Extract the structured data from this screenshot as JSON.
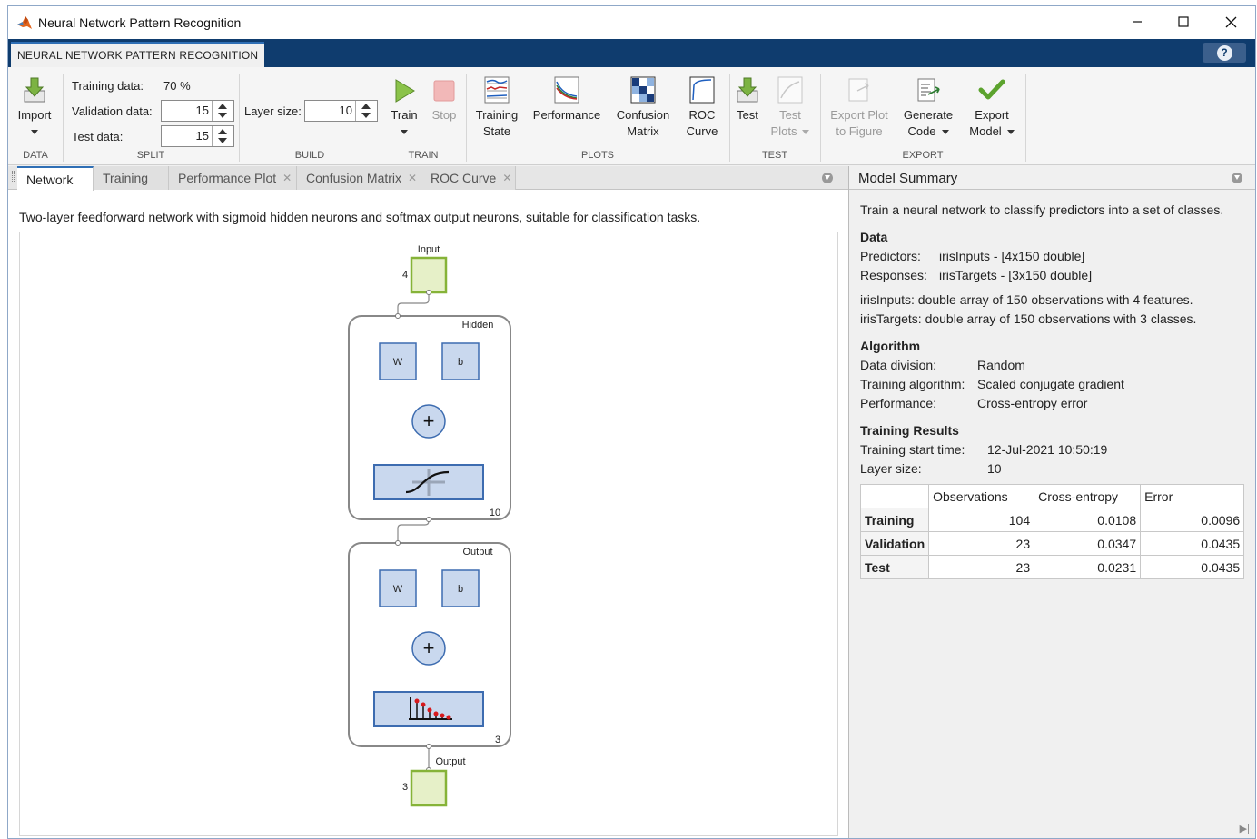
{
  "window": {
    "title": "Neural Network Pattern Recognition",
    "controls": [
      "minimize-icon",
      "maximize-icon",
      "close-icon"
    ]
  },
  "toolstrip_tab": "NEURAL NETWORK PATTERN RECOGNITION",
  "toolstrip": {
    "data": {
      "section": "DATA",
      "import_label": "Import"
    },
    "split": {
      "section": "SPLIT",
      "training_label": "Training data:",
      "training_value": "70 %",
      "validation_label": "Validation data:",
      "validation_value": "15",
      "test_label": "Test data:",
      "test_value": "15"
    },
    "build": {
      "section": "BUILD",
      "layer_size_label": "Layer size:",
      "layer_size_value": "10"
    },
    "train": {
      "section": "TRAIN",
      "train_label": "Train",
      "stop_label": "Stop"
    },
    "plots": {
      "section": "PLOTS",
      "training_state": [
        "Training",
        "State"
      ],
      "performance": "Performance",
      "confusion": [
        "Confusion",
        "Matrix"
      ],
      "roc": [
        "ROC",
        "Curve"
      ]
    },
    "test": {
      "section": "TEST",
      "test_label": "Test",
      "test_plots": [
        "Test",
        "Plots"
      ]
    },
    "export": {
      "section": "EXPORT",
      "export_plot": [
        "Export Plot",
        "to Figure"
      ],
      "generate_code": [
        "Generate",
        "Code"
      ],
      "export_model": [
        "Export",
        "Model"
      ]
    }
  },
  "doc_tabs": [
    "Network",
    "Training",
    "Performance Plot",
    "Confusion Matrix",
    "ROC Curve"
  ],
  "network": {
    "description": "Two-layer feedforward network with sigmoid hidden neurons and softmax output neurons, suitable for classification tasks.",
    "input_label": "Input",
    "input_size": "4",
    "hidden_label": "Hidden",
    "hidden_size": "10",
    "output_layer_label": "Output",
    "output_size": "3",
    "output_label": "Output",
    "output_node_size": "3",
    "w_label": "W",
    "b_label": "b"
  },
  "summary": {
    "title": "Model Summary",
    "intro": "Train a neural network to classify predictors into a set of classes.",
    "data_heading": "Data",
    "predictors_label": "Predictors:",
    "predictors_value": "irisInputs - [4x150 double]",
    "responses_label": "Responses:",
    "responses_value": "irisTargets - [3x150 double]",
    "inputs_note": "irisInputs: double array of 150 observations with 4 features.",
    "targets_note": "irisTargets: double array of 150 observations with 3 classes.",
    "algorithm_heading": "Algorithm",
    "division_label": "Data division:",
    "division_value": "Random",
    "algorithm_label": "Training algorithm:",
    "algorithm_value": "Scaled conjugate gradient",
    "performance_label": "Performance:",
    "performance_value": "Cross-entropy error",
    "results_heading": "Training Results",
    "start_label": "Training start time:",
    "start_value": "12-Jul-2021 10:50:19",
    "layer_label": "Layer size:",
    "layer_value": "10",
    "table": {
      "headers": [
        "",
        "Observations",
        "Cross-entropy",
        "Error"
      ],
      "rows": [
        [
          "Training",
          "104",
          "0.0108",
          "0.0096"
        ],
        [
          "Validation",
          "23",
          "0.0347",
          "0.0435"
        ],
        [
          "Test",
          "23",
          "0.0231",
          "0.0435"
        ]
      ]
    }
  }
}
